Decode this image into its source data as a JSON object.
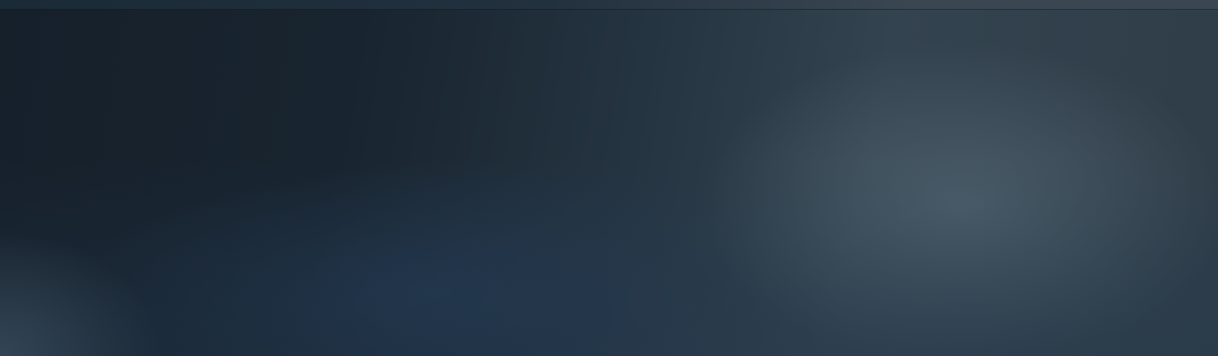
{
  "colors": {
    "top_bar": "#22313e",
    "background_dark": "#16202b",
    "background_mid": "#243340",
    "background_light": "#4a5966"
  }
}
